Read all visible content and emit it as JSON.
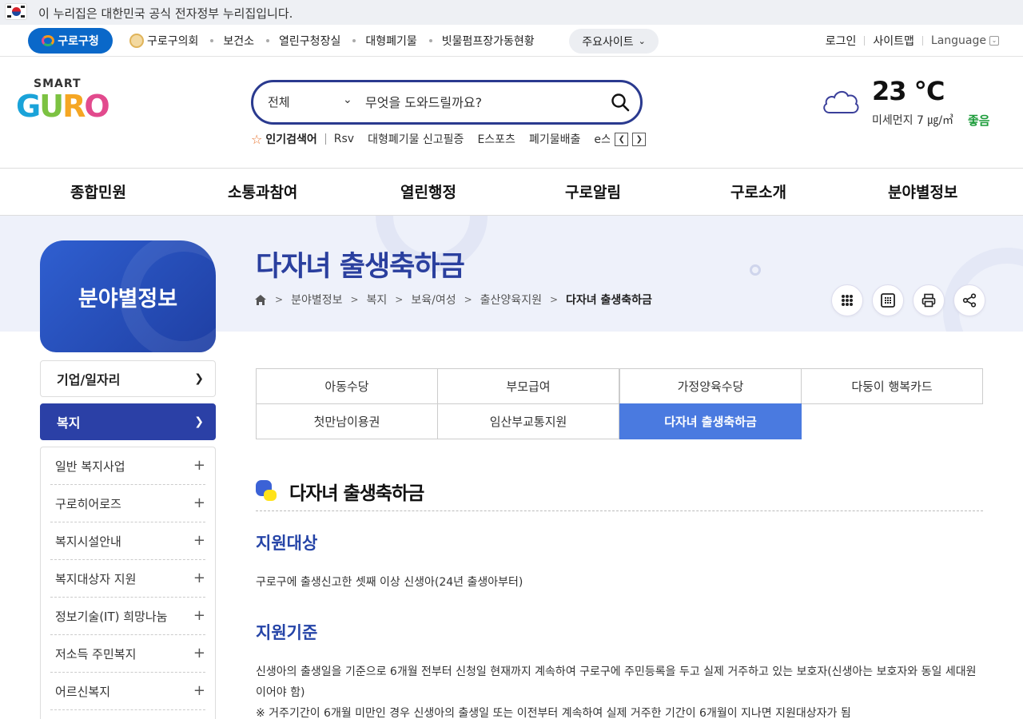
{
  "gov_banner": {
    "text": "이 누리집은 대한민국 공식 전자정부 누리집입니다."
  },
  "util": {
    "home_label": "구로구청",
    "links": [
      "구로구의회",
      "보건소",
      "열린구청장실",
      "대형폐기물",
      "빗물펌프장가동현황"
    ],
    "major_sites": "주요사이트",
    "login": "로그인",
    "sitemap": "사이트맵",
    "language": "Language"
  },
  "logo": {
    "smart": "SMART",
    "g": "G",
    "u": "U",
    "r": "R",
    "o": "O"
  },
  "search": {
    "scope": "전체",
    "placeholder": "무엇을 도와드릴까요?"
  },
  "popular": {
    "title": "인기검색어",
    "keywords": [
      "Rsv",
      "대형폐기물 신고필증",
      "E스포츠",
      "폐기물배출",
      "e스"
    ]
  },
  "weather": {
    "temp": "23 ℃",
    "dust": "미세먼지 7 ㎍/㎥",
    "status": "좋음",
    "status_color": "#1c9c3a"
  },
  "gnb": [
    "종합민원",
    "소통과참여",
    "열린행정",
    "구로알림",
    "구로소개",
    "분야별정보"
  ],
  "side_title": "분야별정보",
  "page_title": "다자녀 출생축하금",
  "breadcrumb": [
    "분야별정보",
    "보육/여성",
    "출산양육지원",
    "다자녀 출생축하금"
  ],
  "breadcrumb_welfare": "복지",
  "lnb": {
    "items": [
      {
        "label": "기업/일자리",
        "active": false
      },
      {
        "label": "복지",
        "active": true
      }
    ],
    "sub_items": [
      "일반 복지사업",
      "구로히어로즈",
      "복지시설안내",
      "복지대상자 지원",
      "정보기술(IT) 희망나눔",
      "저소득 주민복지",
      "어르신복지"
    ]
  },
  "tabs": [
    {
      "label": "아동수당",
      "active": false
    },
    {
      "label": "부모급여",
      "active": false
    },
    {
      "label": "가정양육수당",
      "active": false
    },
    {
      "label": "다둥이 행복카드",
      "active": false
    },
    {
      "label": "첫만남이용권",
      "active": false
    },
    {
      "label": "임산부교통지원",
      "active": false
    },
    {
      "label": "다자녀 출생축하금",
      "active": true
    }
  ],
  "content": {
    "title": "다자녀 출생축하금",
    "sections": [
      {
        "heading": "지원대상",
        "body": "구로구에 출생신고한 셋째 이상 신생아(24년 출생아부터)"
      },
      {
        "heading": "지원기준",
        "body": "신생아의 출생일을 기준으로 6개월 전부터 신청일 현재까지 계속하여 구로구에 주민등록을 두고 실제 거주하고 있는 보호자(신생아는 보호자와 동일 세대원이어야 함)",
        "note": "※ 거주기간이 6개월 미만인 경우 신생아의 출생일 또는 이전부터 계속하여 실제 거주한 기간이 6개월이 지나면 지원대상자가 됨"
      }
    ]
  },
  "colors": {
    "primary": "#2b40a6",
    "accent": "#4a7ae0",
    "title": "#2a3f9e"
  }
}
